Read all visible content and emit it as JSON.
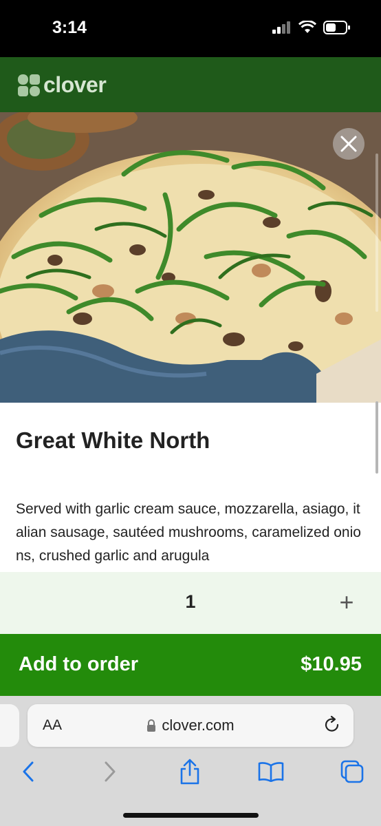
{
  "status_bar": {
    "time": "3:14"
  },
  "header": {
    "brand": "clover"
  },
  "item": {
    "title": "Great White North",
    "description": "Served with garlic cream sauce, mozzarella, asiago, italian sausage, sautéed mushrooms, caramelized onions, crushed garlic and arugula"
  },
  "quantity": {
    "value": "1",
    "plus": "+"
  },
  "add_to_order": {
    "label": "Add to order",
    "price": "$10.95"
  },
  "browser": {
    "text_size_label": "AA",
    "url": "clover.com"
  },
  "icons": {
    "close": "close-icon",
    "lock": "lock-icon",
    "reload": "reload-icon",
    "back": "back-icon",
    "forward": "forward-icon",
    "share": "share-icon",
    "bookmarks": "bookmarks-icon",
    "tabs": "tabs-icon"
  },
  "colors": {
    "header_green": "#1f5a1a",
    "add_button_green": "#238b0b",
    "quantity_bg": "#eef7ec",
    "safari_blue": "#1a73e8"
  }
}
